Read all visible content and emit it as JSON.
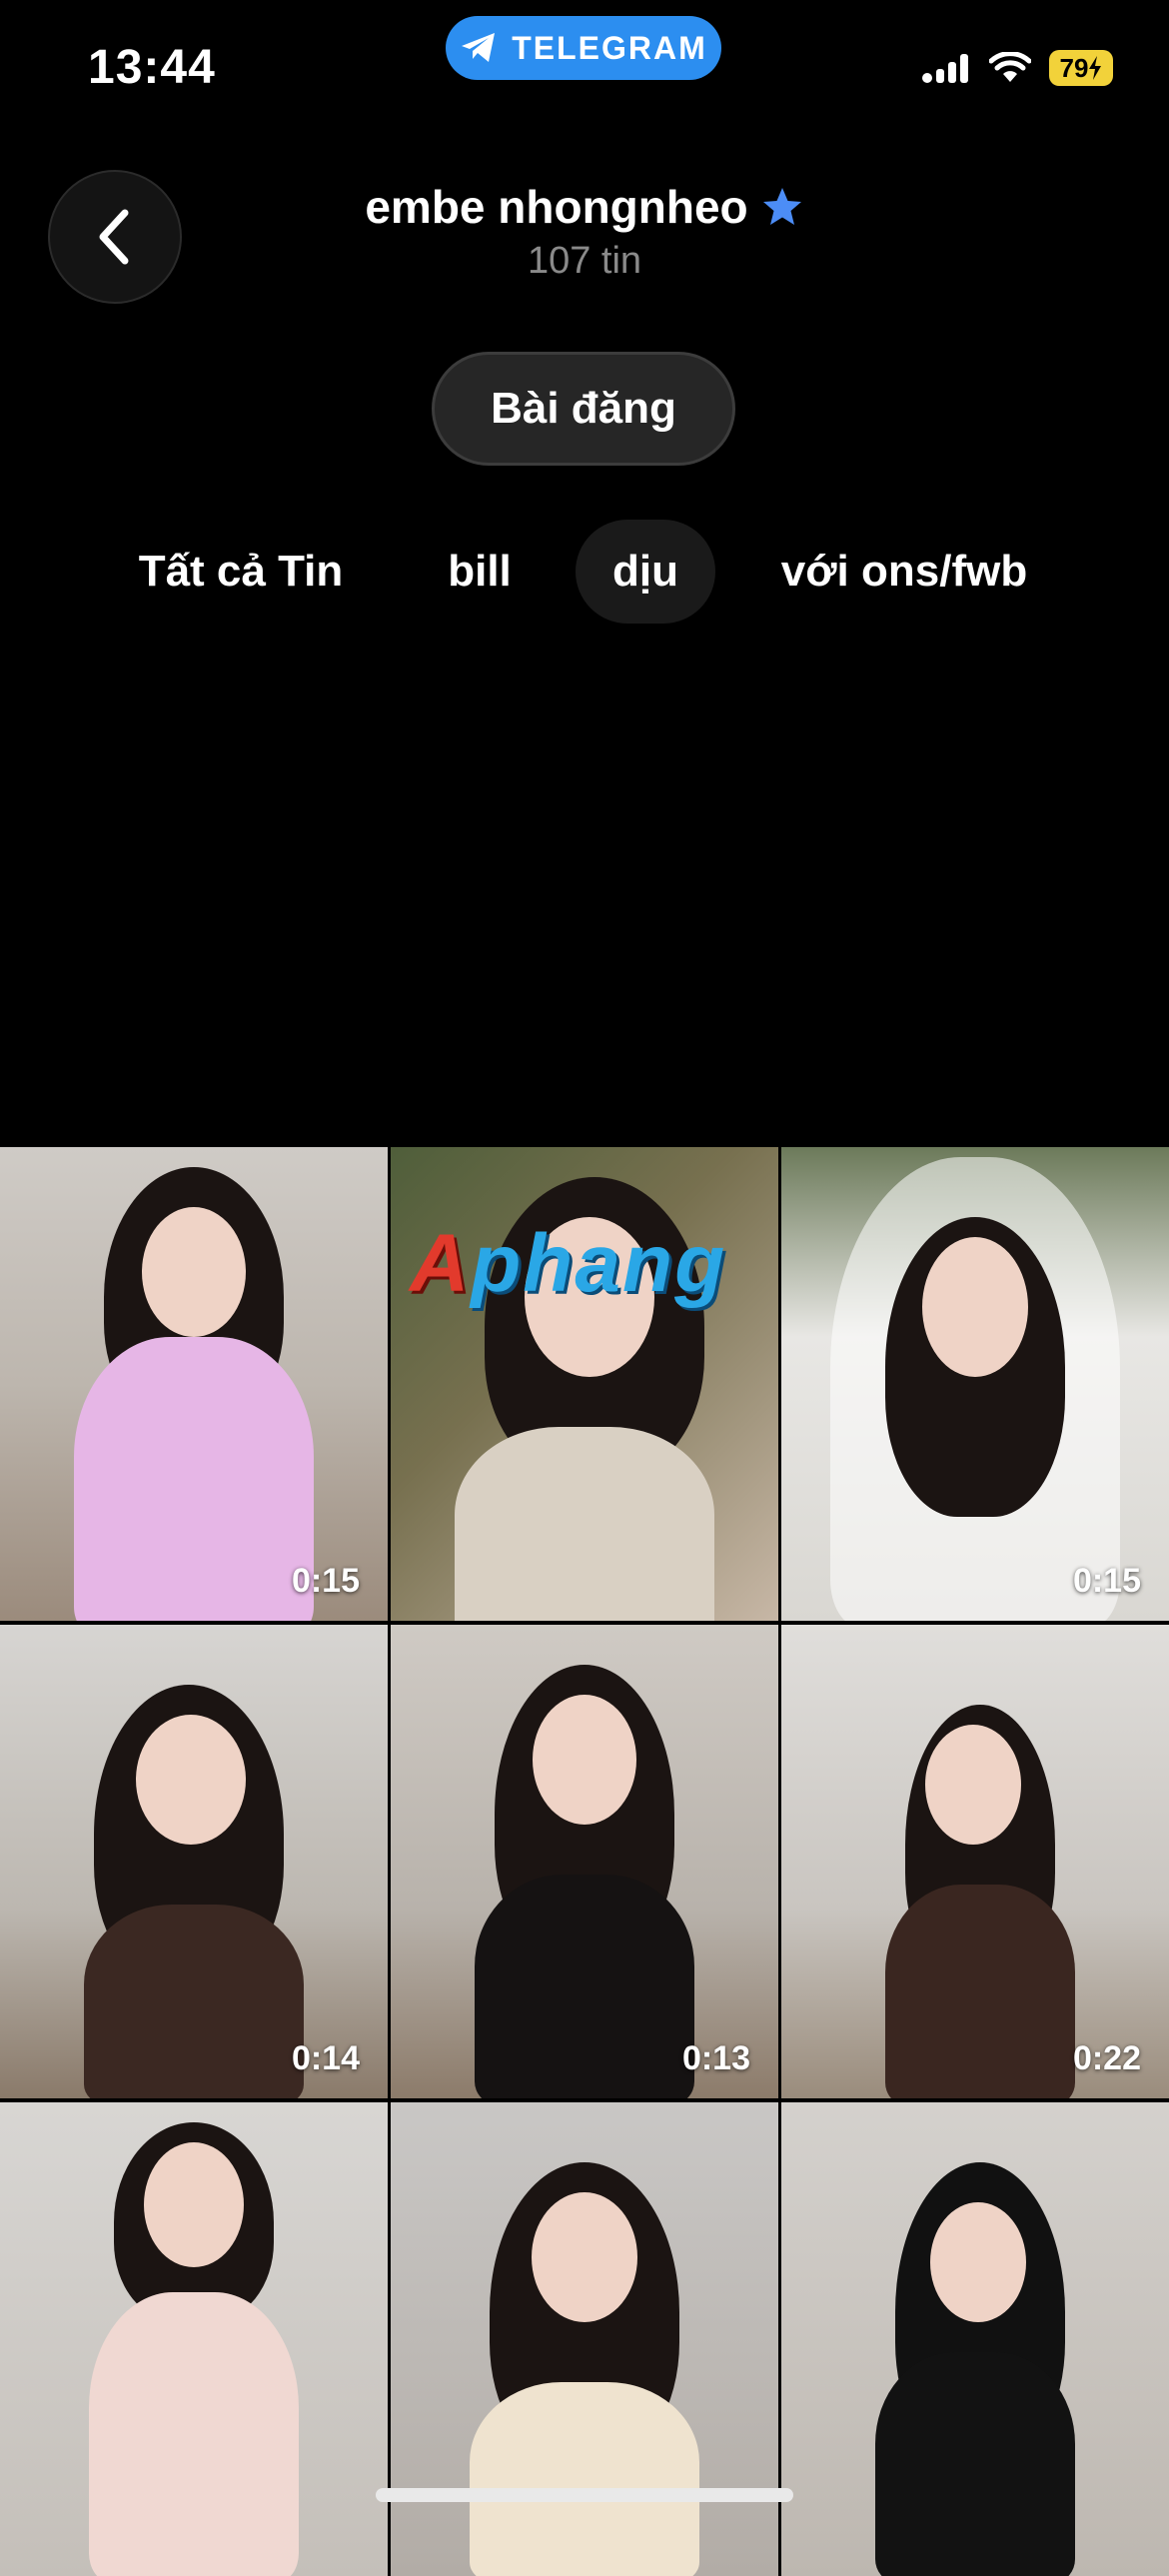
{
  "status": {
    "time": "13:44",
    "app_pill_label": "TELEGRAM",
    "battery": "79"
  },
  "header": {
    "title": "embe nhongnheo",
    "subtitle": "107 tin",
    "posts_button": "Bài đăng"
  },
  "tabs": [
    {
      "label": "Tất cả Tin"
    },
    {
      "label": "bill"
    },
    {
      "label": "dịu"
    },
    {
      "label": "với ons/fwb"
    }
  ],
  "watermark": {
    "first": "A",
    "rest": "phang"
  },
  "grid": {
    "tiles": [
      {
        "duration": "0:15"
      },
      {
        "duration": ""
      },
      {
        "duration": "0:15"
      },
      {
        "duration": "0:14"
      },
      {
        "duration": "0:13"
      },
      {
        "duration": "0:22"
      },
      {
        "duration": ""
      },
      {
        "duration": ""
      },
      {
        "duration": ""
      }
    ]
  },
  "icons": {
    "back": "chevron-left-icon",
    "verified": "star-icon",
    "telegram": "telegram-plane-icon"
  },
  "colors": {
    "telegram_blue": "#2c8ef0",
    "battery_yellow": "#f2d23a",
    "verified_blue": "#4c8df6"
  }
}
